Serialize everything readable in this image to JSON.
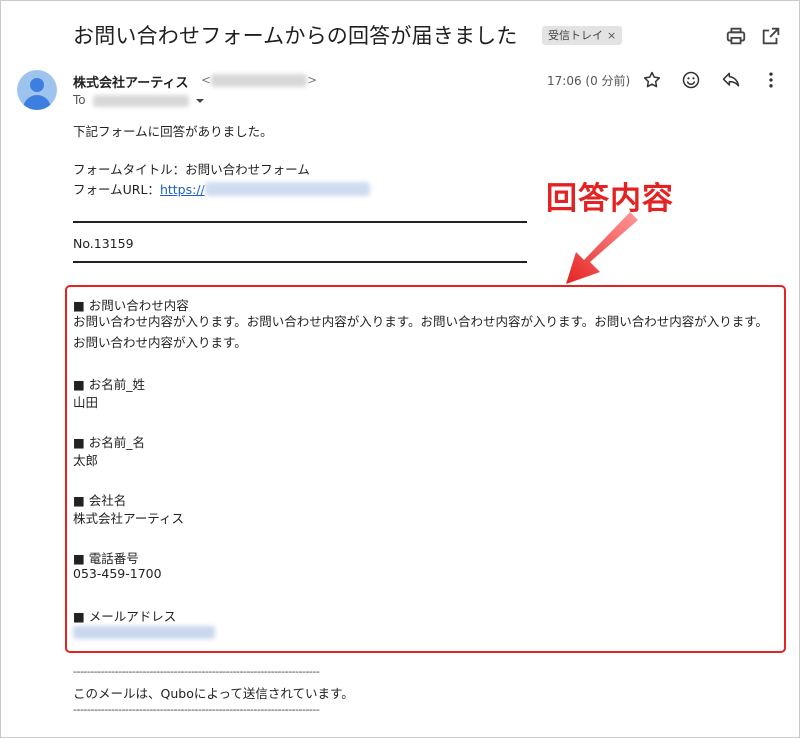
{
  "email": {
    "subject": "お問い合わせフォームからの回答が届きました",
    "label_chip": "受信トレイ",
    "label_chip_close": "×",
    "sender_name": "株式会社アーティス",
    "to_label": "To",
    "time": "17:06 (0 分前)"
  },
  "body": {
    "intro": "下記フォームに回答がありました。",
    "form_title_line": "フォームタイトル：お問い合わせフォーム",
    "form_url_label": "フォームURL：",
    "form_url_link": "https://",
    "number": "No.13159"
  },
  "callout": {
    "text": "回答内容",
    "color": "#e52222"
  },
  "fields": [
    {
      "label": "■ お問い合わせ内容",
      "value": "お問い合わせ内容が入ります。お問い合わせ内容が入ります。お問い合わせ内容が入ります。お問い合わせ内容が入ります。お問い合わせ内容が入ります。"
    },
    {
      "label": "■ お名前_姓",
      "value": "山田"
    },
    {
      "label": "■ お名前_名",
      "value": "太郎"
    },
    {
      "label": "■ 会社名",
      "value": "株式会社アーティス"
    },
    {
      "label": "■ 電話番号",
      "value": "053-459-1700"
    },
    {
      "label": "■ メールアドレス",
      "value": ""
    }
  ],
  "footer": {
    "divider": "-----------------------------------------------------------------------",
    "note": "このメールは、Quboによって送信されています。"
  },
  "icons": {
    "print": "print-icon",
    "open_new": "open-in-new-icon",
    "star": "star-icon",
    "emoji": "emoji-icon",
    "reply": "reply-icon",
    "more": "more-vert-icon"
  }
}
